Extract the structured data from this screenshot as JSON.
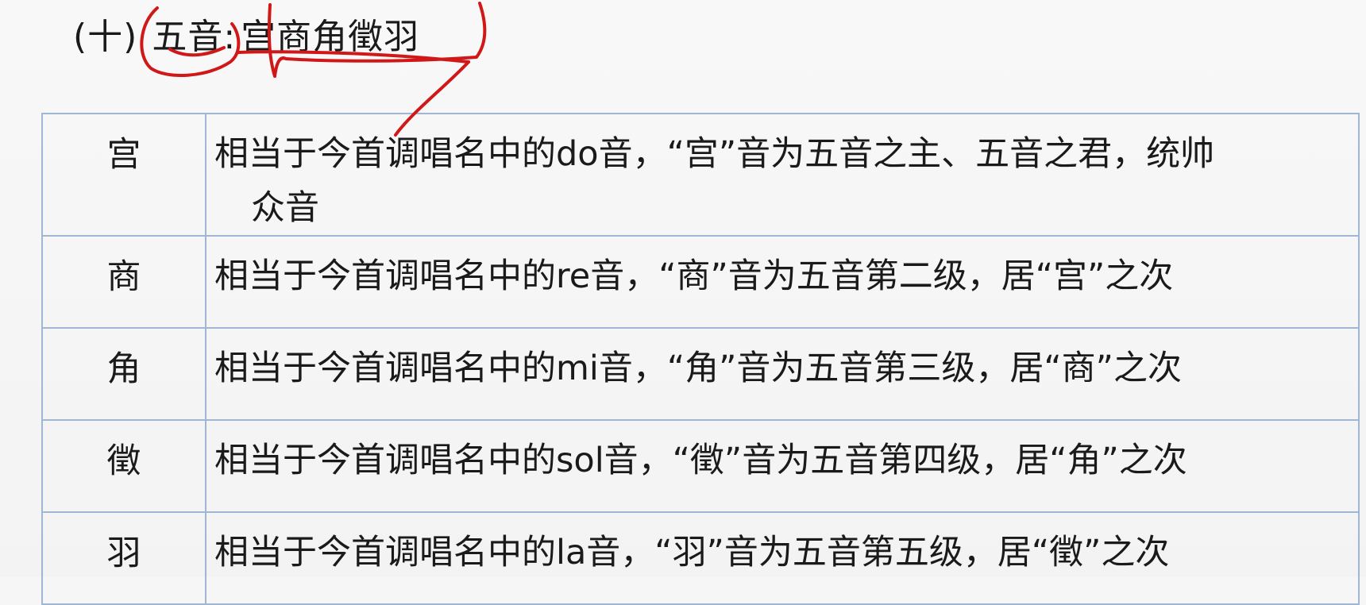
{
  "heading": {
    "number": "(十)",
    "topic": "五音:",
    "notes": "宫商角徵羽"
  },
  "rows": [
    {
      "name": "宫",
      "desc_line1": "相当于今首调唱名中的do音，“宫”音为五音之主、五音之君，统帅",
      "desc_line2": "众音"
    },
    {
      "name": "商",
      "desc": "相当于今首调唱名中的re音，“商”音为五音第二级，居“宫”之次"
    },
    {
      "name": "角",
      "desc": "相当于今首调唱名中的mi音，“角”音为五音第三级，居“商”之次"
    },
    {
      "name": "徵",
      "desc": "相当于今首调唱名中的sol音，“徵”音为五音第四级，居“角”之次"
    },
    {
      "name": "羽",
      "desc": "相当于今首调唱名中的la音，“羽”音为五音第五级，居“徵”之次"
    }
  ],
  "colors": {
    "border": "#9fb7d5",
    "annotation": "#d01818"
  }
}
